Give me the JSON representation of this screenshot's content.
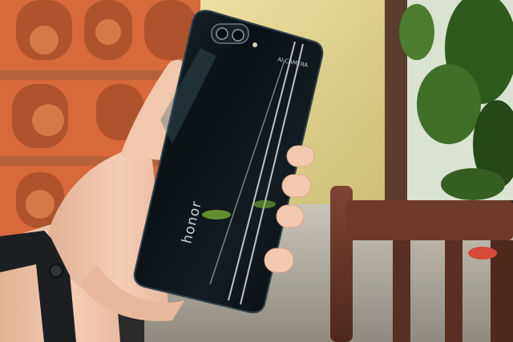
{
  "photo": {
    "phone": {
      "brand_logo": "honor",
      "camera_label": "AI CAMERA",
      "body_color": "#0b1014"
    },
    "colors": {
      "brick_wall": "#e2713a",
      "brick_shadow": "#a8502a",
      "yellow_wall": "#e3d48f",
      "foliage": "#2f5a1e",
      "chair_wood": "#6a3628",
      "floor": "#b9b4a8",
      "skin": "#f0c7ae",
      "wristband": "#1c1f22"
    }
  }
}
